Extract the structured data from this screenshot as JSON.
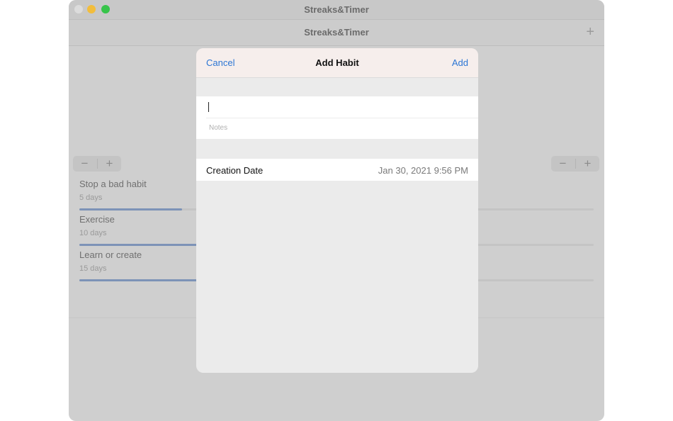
{
  "window": {
    "title": "Streaks&Timer"
  },
  "navbar": {
    "title": "Streaks&Timer",
    "add_glyph": "+"
  },
  "stepper": {
    "minus": "−",
    "plus": "+"
  },
  "habits": [
    {
      "name": "Stop a bad habit",
      "days": "5 days",
      "progress": 0.2
    },
    {
      "name": "Exercise",
      "days": "10 days",
      "progress": 0.4
    },
    {
      "name": "Learn or create",
      "days": "15 days",
      "progress": 0.6
    }
  ],
  "sheet": {
    "cancel_label": "Cancel",
    "title": "Add Habit",
    "add_label": "Add",
    "title_value": "",
    "notes_placeholder": "Notes",
    "creation_date_label": "Creation Date",
    "creation_date_value": "Jan 30, 2021 9:56 PM"
  },
  "colors": {
    "accent": "#2c76d4",
    "progress_fill": "#7d93b7",
    "traffic_close": "#dcdcdc",
    "traffic_minimize": "#f2bd3c",
    "traffic_maximize": "#37c44a"
  }
}
